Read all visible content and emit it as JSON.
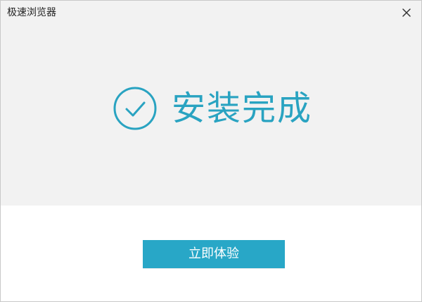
{
  "window": {
    "title": "极速浏览器"
  },
  "status": {
    "text": "安装完成",
    "icon": "check-circle-icon",
    "accent": "#29a3c1"
  },
  "actions": {
    "primary_label": "立即体验",
    "primary_color": "#28a7c7"
  },
  "controls": {
    "close_icon": "close-icon"
  }
}
